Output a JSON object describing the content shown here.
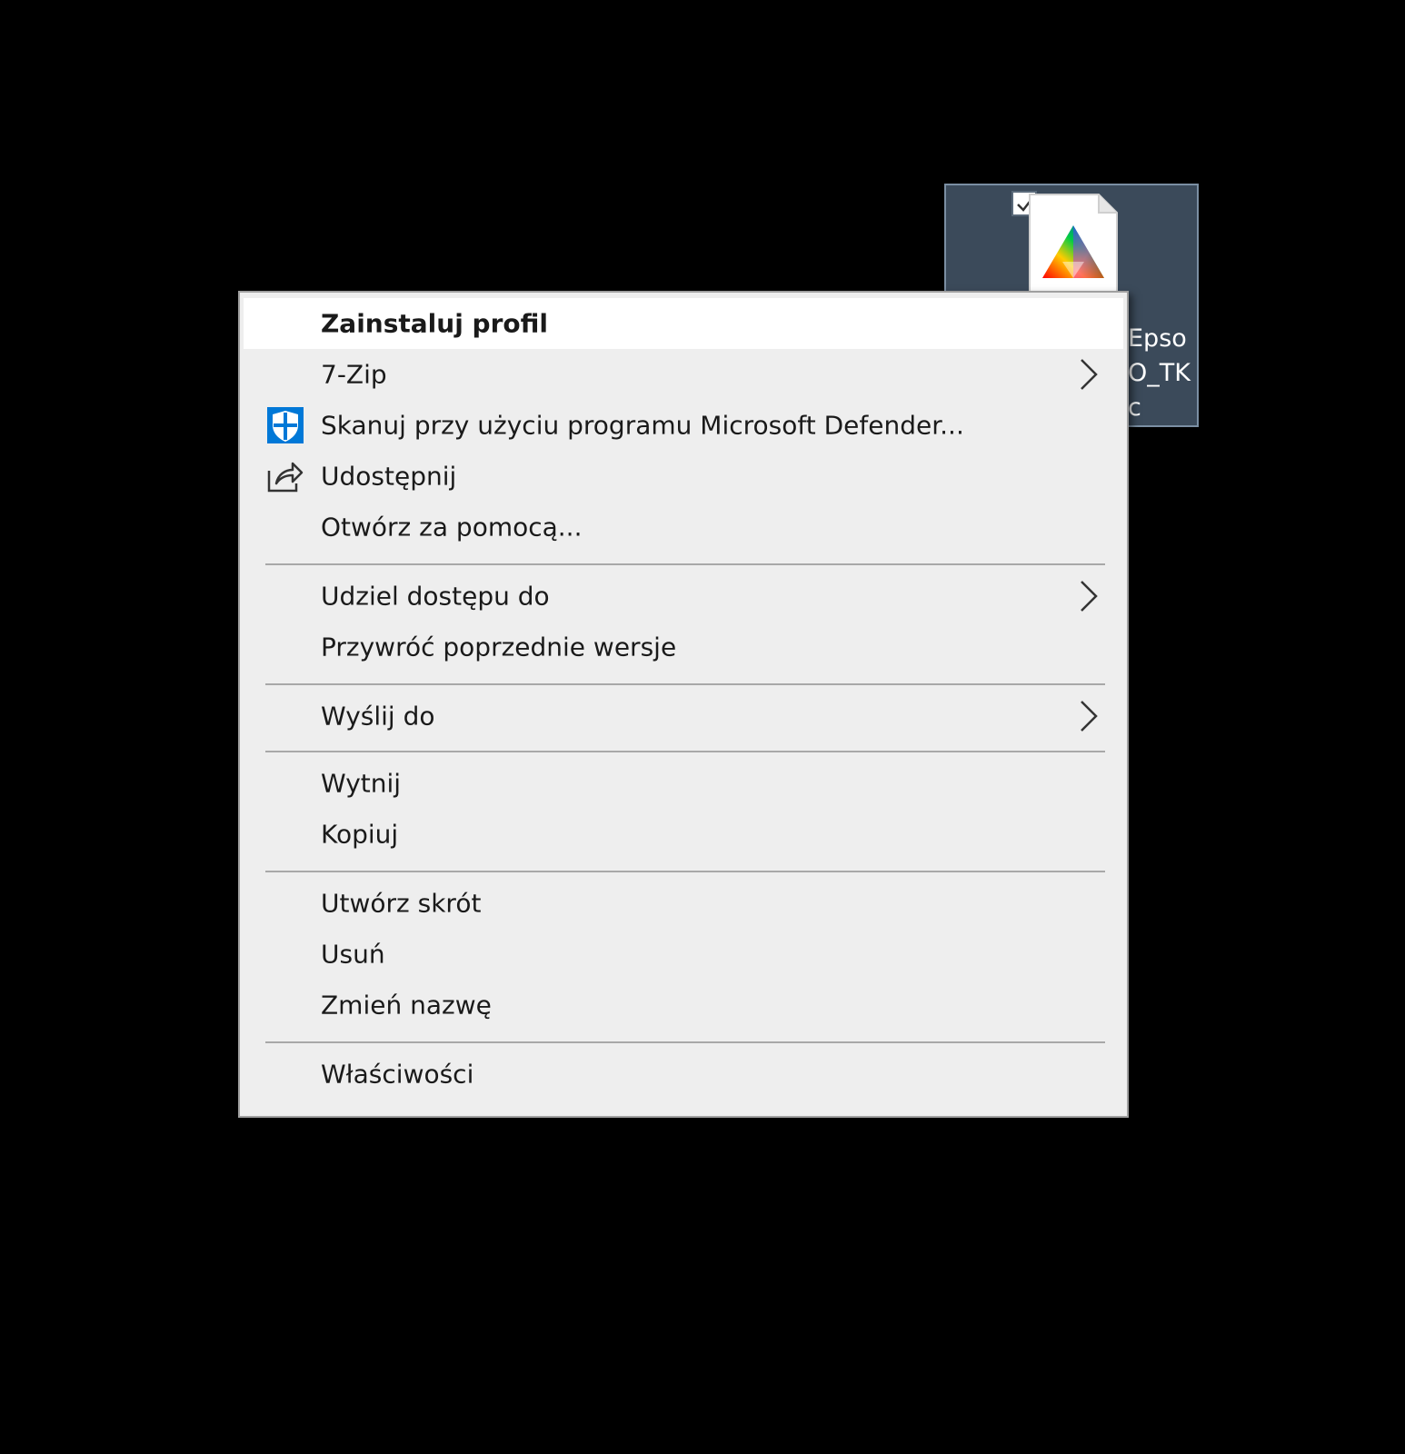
{
  "desktop_icon": {
    "label_lines": "Epso\nO_TK\nc",
    "checked": true
  },
  "menu": {
    "items": [
      {
        "label": "Zainstaluj profil",
        "bold": true
      },
      {
        "label": "7-Zip",
        "submenu": true
      },
      {
        "label": "Skanuj przy użyciu programu Microsoft Defender...",
        "icon": "defender-shield-icon"
      },
      {
        "label": "Udostępnij",
        "icon": "share-icon"
      },
      {
        "label": "Otwórz za pomocą..."
      },
      {
        "label": "Udziel dostępu do",
        "submenu": true
      },
      {
        "label": "Przywróć poprzednie wersje"
      },
      {
        "label": "Wyślij do",
        "submenu": true
      },
      {
        "label": "Wytnij"
      },
      {
        "label": "Kopiuj"
      },
      {
        "label": "Utwórz skrót"
      },
      {
        "label": "Usuń"
      },
      {
        "label": "Zmień nazwę"
      },
      {
        "label": "Właściwości"
      }
    ]
  },
  "colors": {
    "menu_background": "#eeeeee",
    "highlight": "#ffffff",
    "defender_blue": "#0078d7",
    "icon_selection": "#3b4a5a"
  }
}
